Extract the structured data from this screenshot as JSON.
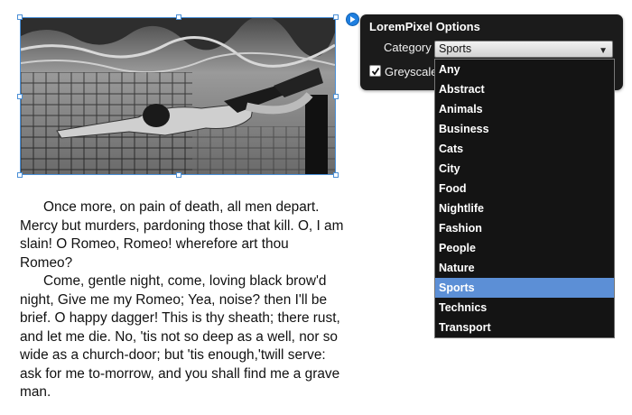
{
  "image": {
    "alt_semantic": "swimmer-photo"
  },
  "passage": {
    "paragraphs": [
      "Once more, on pain of death, all men depart. Mercy but murders, pardoning those that kill. O, I am slain! O Romeo, Romeo! wherefore art thou Romeo?",
      "Come, gentle night,  come, loving black brow'd night, Give me my Romeo; Yea, noise? then I'll be brief. O happy dagger! This is thy sheath; there rust, and let me die. No, 'tis not so deep as a well, nor so wide as a church-door; but 'tis enough,'twill serve: ask for me to-morrow, and you shall find me a grave man."
    ]
  },
  "panel": {
    "title": "LoremPixel Options",
    "category_label": "Category",
    "category_value": "Sports",
    "greyscale_label": "Greyscale",
    "greyscale_checked": true
  },
  "dropdown": {
    "options": [
      "Any",
      "Abstract",
      "Animals",
      "Business",
      "Cats",
      "City",
      "Food",
      "Nightlife",
      "Fashion",
      "People",
      "Nature",
      "Sports",
      "Technics",
      "Transport"
    ],
    "selected": "Sports"
  },
  "colors": {
    "accent": "#1f7fe0",
    "selection": "#5c8fd6",
    "panel_bg": "#1b1b1b",
    "handle_border": "#4a8fd6"
  }
}
